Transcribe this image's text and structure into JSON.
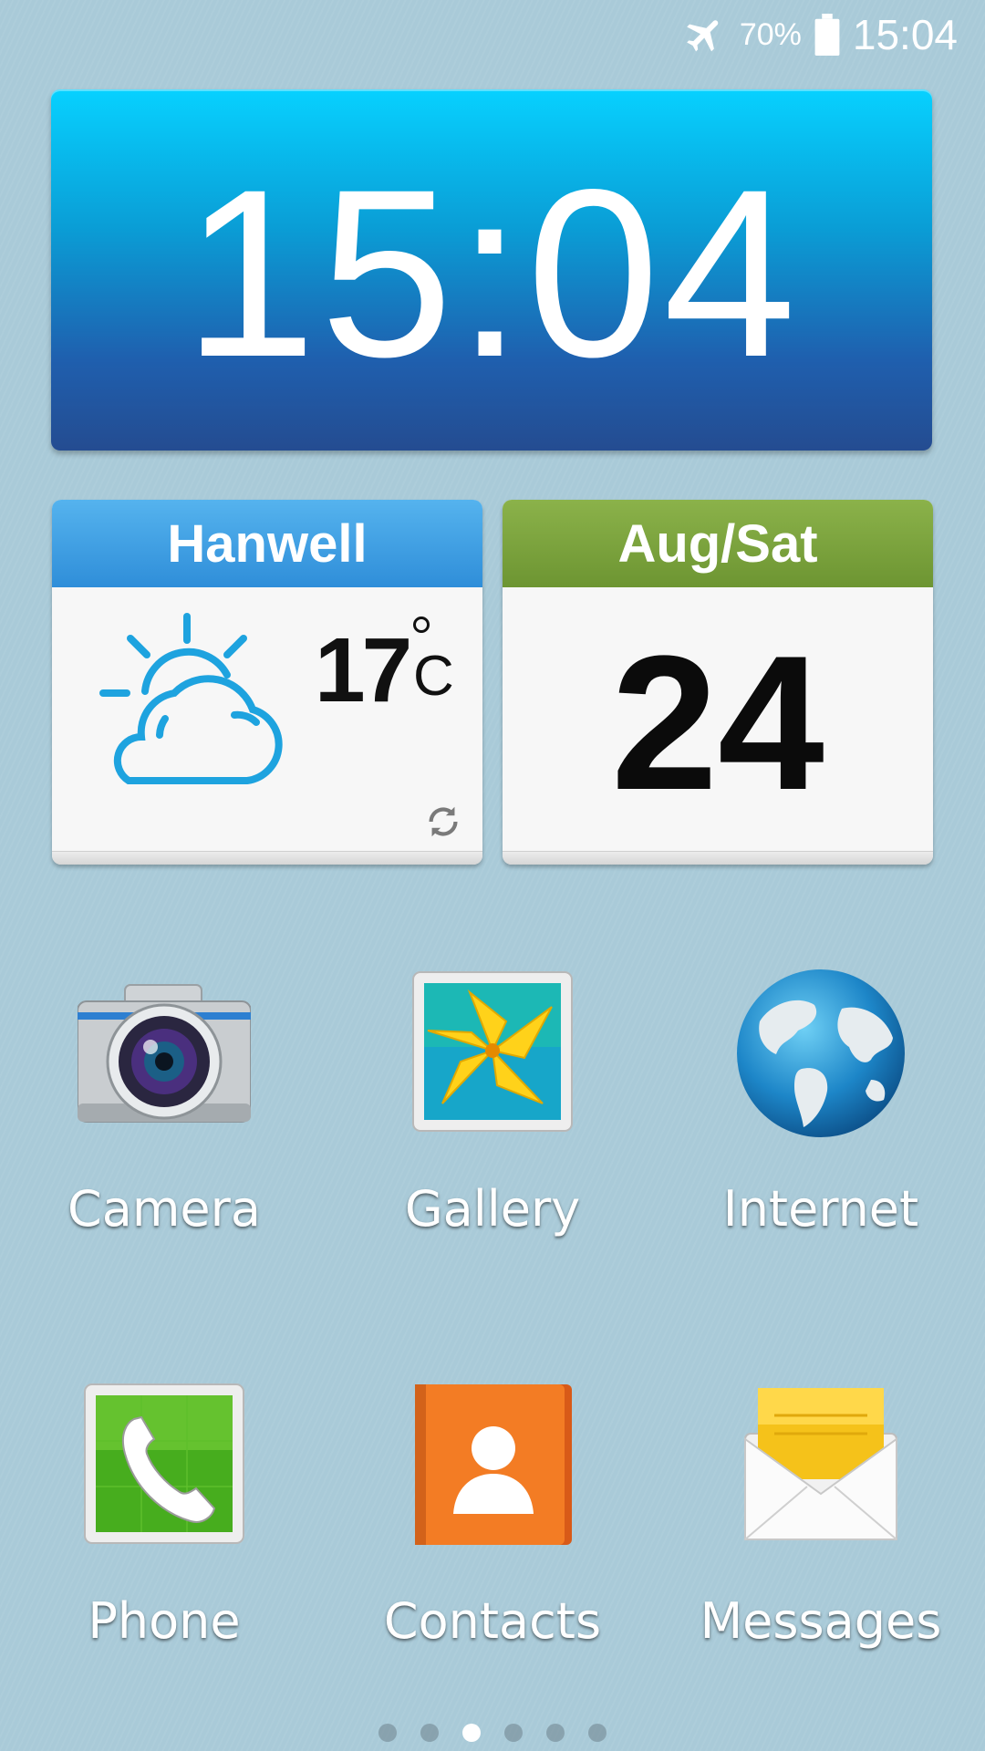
{
  "status_bar": {
    "airplane_icon": "airplane-icon",
    "battery_percent": "70%",
    "battery_icon": "battery-icon",
    "time": "15:04"
  },
  "clock_widget": {
    "time": "15:04"
  },
  "weather_widget": {
    "location": "Hanwell",
    "temperature": "17",
    "unit": "C",
    "condition_icon": "partly-cloudy-icon",
    "refresh_icon": "refresh-icon"
  },
  "date_widget": {
    "month_weekday": "Aug/Sat",
    "day": "24"
  },
  "apps": [
    {
      "label": "Camera",
      "icon": "camera-icon"
    },
    {
      "label": "Gallery",
      "icon": "gallery-icon"
    },
    {
      "label": "Internet",
      "icon": "globe-icon"
    },
    {
      "label": "Phone",
      "icon": "phone-icon"
    },
    {
      "label": "Contacts",
      "icon": "contacts-icon"
    },
    {
      "label": "Messages",
      "icon": "messages-icon"
    }
  ],
  "page_indicator": {
    "count": 6,
    "active_index": 2
  },
  "colors": {
    "wallpaper": "#a9cad8",
    "clock_top": "#07d1ff",
    "clock_bottom": "#244c91",
    "weather_header": "#3d9ee3",
    "date_header": "#7aa33c"
  }
}
